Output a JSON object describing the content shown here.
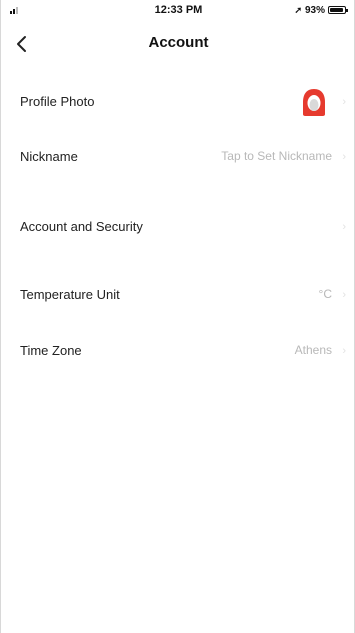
{
  "status_bar": {
    "time": "12:33 PM",
    "battery_percent": "93%",
    "location_icon": "location-arrow-icon",
    "battery_icon": "battery-icon"
  },
  "nav": {
    "title": "Account",
    "back_icon": "chevron-left-icon"
  },
  "rows": [
    {
      "label": "Profile Photo",
      "value": "",
      "icon": "avatar-icon"
    },
    {
      "label": "Nickname",
      "value": "Tap to Set Nickname"
    },
    {
      "label": "Account and Security",
      "value": ""
    },
    {
      "label": "Temperature Unit",
      "value": "°C"
    },
    {
      "label": "Time Zone",
      "value": "Athens"
    }
  ],
  "colors": {
    "avatar_red": "#e63a2e",
    "value_text": "#b8b8b8",
    "label_text": "#222222"
  }
}
